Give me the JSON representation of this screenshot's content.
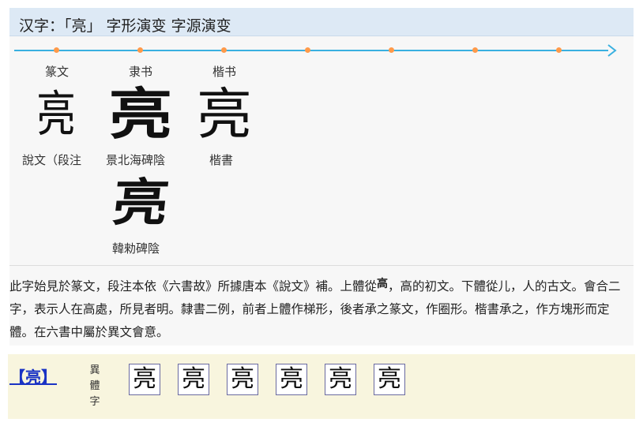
{
  "header": {
    "title": "汉字：「亮」 字形演变 字源演变"
  },
  "timeline": {
    "stages": [
      {
        "label": "篆文",
        "glyph": "亮",
        "caption": "說文（段注"
      },
      {
        "label": "隶书",
        "glyph": "亮",
        "caption": "景北海碑陰"
      },
      {
        "label": "楷书",
        "glyph": "亮",
        "caption": "楷書"
      }
    ],
    "extra": {
      "glyph": "亮",
      "caption": "韓勑碑陰"
    }
  },
  "description": {
    "part1": "此字始見於篆文，段注本依《六書故》所據唐本《說文》補。上體從",
    "inline_glyph": "高",
    "part2": "，高的初文。下體從儿，人的古文。會合二字，表示人在高處，所見者明。隸書二例，前者上體作梯形，後者承之篆文，作圈形。楷書承之，作方塊形而定體。在六書中屬於異文會意。"
  },
  "variants": {
    "head": "【亮】",
    "kind": "異體字",
    "items": [
      "亮",
      "亮",
      "亮",
      "亮",
      "亮",
      "亮"
    ]
  }
}
